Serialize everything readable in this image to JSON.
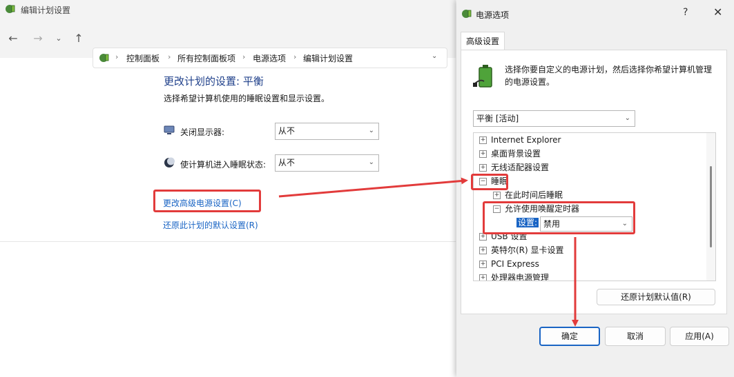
{
  "background_window": {
    "title": "编辑计划设置",
    "breadcrumbs": [
      "控制面板",
      "所有控制面板项",
      "电源选项",
      "编辑计划设置"
    ],
    "heading": "更改计划的设置: 平衡",
    "subheading": "选择希望计算机使用的睡眠设置和显示设置。",
    "display_off_label": "关闭显示器:",
    "display_off_value": "从不",
    "sleep_label": "使计算机进入睡眠状态:",
    "sleep_value": "从不",
    "advanced_link": "更改高级电源设置(C)",
    "restore_link": "还原此计划的默认设置(R)"
  },
  "dialog": {
    "title": "电源选项",
    "help": "?",
    "close": "✕",
    "tab": "高级设置",
    "description": "选择你要自定义的电源计划，然后选择你希望计算机管理的电源设置。",
    "plan": "平衡 [活动]",
    "tree": [
      {
        "label": "Internet Explorer",
        "expander": "+"
      },
      {
        "label": "桌面背景设置",
        "expander": "+"
      },
      {
        "label": "无线适配器设置",
        "expander": "+"
      },
      {
        "label": "睡眠",
        "expander": "−"
      },
      {
        "label": "在此时间后睡眠",
        "expander": "+"
      },
      {
        "label": "允许使用唤醒定时器",
        "expander": "−"
      },
      {
        "label": "USB 设置",
        "expander": "+"
      },
      {
        "label": "英特尔(R) 显卡设置",
        "expander": "+"
      },
      {
        "label": "PCI Express",
        "expander": "+"
      },
      {
        "label": "处理器电源管理",
        "expander": "+"
      }
    ],
    "setting_label": "设置:",
    "setting_value": "禁用",
    "restore_defaults": "还原计划默认值(R)",
    "ok": "确定",
    "cancel": "取消",
    "apply": "应用(A)"
  },
  "colors": {
    "accent": "#1964c4",
    "highlight": "#e23b3b",
    "selection": "#cce4f7"
  }
}
